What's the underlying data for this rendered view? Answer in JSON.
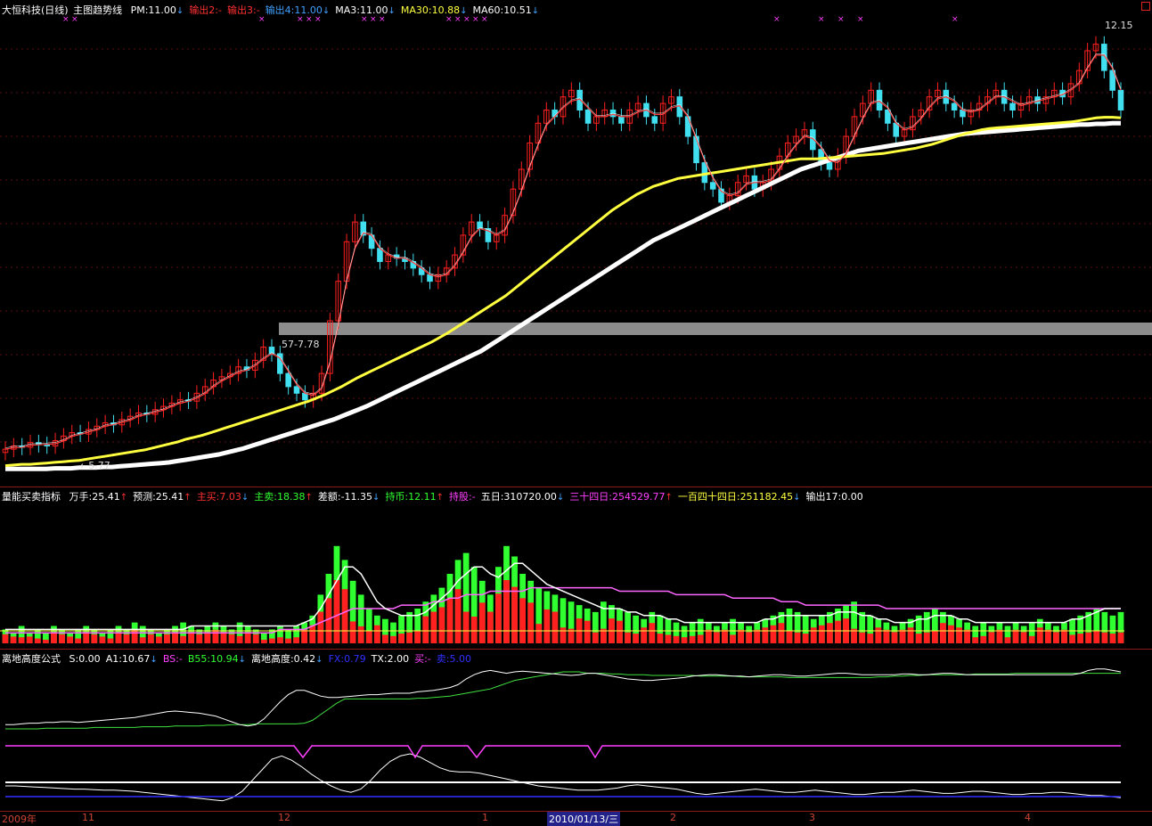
{
  "main": {
    "title": "大恒科技(日线)",
    "indicator": "主图趋势线",
    "items": [
      {
        "text": "PM:11.00",
        "color": "#ffffff",
        "arrow": "↓"
      },
      {
        "text": "输出2:-",
        "color": "#ff3030",
        "arrow": ""
      },
      {
        "text": "输出3:-",
        "color": "#ff3030",
        "arrow": ""
      },
      {
        "text": "输出4:11.00",
        "color": "#40a0ff",
        "arrow": "↓"
      },
      {
        "text": "MA3:11.00",
        "color": "#ffffff",
        "arrow": "↓"
      },
      {
        "text": "MA30:10.88",
        "color": "#ffff40",
        "arrow": "↓"
      },
      {
        "text": "MA60:10.51",
        "color": "#ffffff",
        "arrow": "↓"
      }
    ],
    "high_label": "12.15",
    "low_label": "5.77",
    "mid_label": "57-7.78"
  },
  "volume": {
    "title": "量能买卖指标",
    "items": [
      {
        "text": "万手:25.41",
        "color": "#ffffff",
        "arrow": "↑"
      },
      {
        "text": "预测:25.41",
        "color": "#ffffff",
        "arrow": "↑"
      },
      {
        "text": "主买:7.03",
        "color": "#ff3030",
        "arrow": "↓"
      },
      {
        "text": "主卖:18.38",
        "color": "#30ff30",
        "arrow": "↑"
      },
      {
        "text": "差额:-11.35",
        "color": "#ffffff",
        "arrow": "↓"
      },
      {
        "text": "持币:12.11",
        "color": "#30ff30",
        "arrow": "↑"
      },
      {
        "text": "持股:-",
        "color": "#ff40ff",
        "arrow": ""
      },
      {
        "text": "五日:310720.00",
        "color": "#ffffff",
        "arrow": "↓"
      },
      {
        "text": "三十四日:254529.77",
        "color": "#ff40ff",
        "arrow": "↑"
      },
      {
        "text": "一百四十四日:251182.45",
        "color": "#ffff40",
        "arrow": "↓"
      },
      {
        "text": "输出17:0.00",
        "color": "#ffffff",
        "arrow": ""
      }
    ]
  },
  "indicator": {
    "title": "离地高度公式",
    "items": [
      {
        "text": "S:0.00",
        "color": "#ffffff",
        "arrow": ""
      },
      {
        "text": "A1:10.67",
        "color": "#ffffff",
        "arrow": "↓"
      },
      {
        "text": "BS:-",
        "color": "#ff40ff",
        "arrow": ""
      },
      {
        "text": "B55:10.94",
        "color": "#30ff30",
        "arrow": "↓"
      },
      {
        "text": "离地高度:0.42",
        "color": "#ffffff",
        "arrow": "↓"
      },
      {
        "text": "FX:0.79",
        "color": "#3030ff",
        "arrow": ""
      },
      {
        "text": "TX:2.00",
        "color": "#ffffff",
        "arrow": ""
      },
      {
        "text": "买:-",
        "color": "#ff40ff",
        "arrow": ""
      },
      {
        "text": "卖:5.00",
        "color": "#3030ff",
        "arrow": ""
      }
    ]
  },
  "date_axis": {
    "labels": [
      "2009年",
      "11",
      "12",
      "1",
      "2",
      "3",
      "4"
    ],
    "selected": "2010/01/13/三"
  },
  "colors": {
    "up": "#ff2020",
    "down": "#40e0f0",
    "ma30": "#ffff40",
    "ma60": "#ffffff",
    "grid": "#8a1a1a",
    "vol_up": "#ff2020",
    "vol_down": "#30ff30"
  },
  "chart_data": [
    {
      "type": "candlestick",
      "title": "大恒科技(日线)",
      "ylim": [
        5.5,
        12.4
      ],
      "close": [
        5.85,
        5.9,
        5.88,
        5.95,
        5.92,
        5.9,
        5.98,
        6.05,
        6.1,
        6.08,
        6.15,
        6.2,
        6.25,
        6.22,
        6.3,
        6.35,
        6.4,
        6.38,
        6.45,
        6.5,
        6.55,
        6.6,
        6.58,
        6.7,
        6.8,
        6.9,
        6.95,
        7.0,
        7.1,
        7.05,
        7.2,
        7.4,
        7.3,
        7.0,
        6.8,
        6.7,
        6.6,
        6.7,
        7.0,
        7.8,
        8.4,
        9.0,
        9.3,
        9.1,
        8.9,
        8.7,
        8.8,
        8.75,
        8.7,
        8.6,
        8.5,
        8.4,
        8.5,
        8.6,
        8.8,
        9.1,
        9.3,
        9.2,
        9.0,
        9.1,
        9.4,
        9.8,
        10.1,
        10.5,
        10.8,
        11.0,
        10.9,
        11.2,
        11.3,
        11.0,
        10.8,
        10.9,
        11.0,
        10.9,
        10.8,
        11.0,
        11.1,
        10.9,
        10.8,
        11.1,
        11.2,
        10.9,
        10.6,
        10.2,
        9.9,
        9.8,
        9.6,
        9.7,
        9.9,
        10.0,
        9.8,
        9.9,
        10.1,
        10.3,
        10.5,
        10.6,
        10.7,
        10.4,
        10.2,
        10.1,
        10.3,
        10.6,
        10.9,
        11.1,
        11.3,
        11.0,
        10.8,
        10.6,
        10.7,
        10.9,
        11.0,
        11.2,
        11.3,
        11.1,
        11.0,
        10.9,
        11.0,
        11.1,
        11.2,
        11.3,
        11.1,
        11.0,
        11.1,
        11.2,
        11.1,
        11.2,
        11.3,
        11.2,
        11.4,
        11.6,
        11.9,
        12.0,
        11.6,
        11.3,
        11.0
      ],
      "ma30": [
        5.6,
        5.61,
        5.62,
        5.62,
        5.63,
        5.64,
        5.65,
        5.66,
        5.67,
        5.68,
        5.7,
        5.72,
        5.74,
        5.76,
        5.78,
        5.8,
        5.82,
        5.84,
        5.87,
        5.9,
        5.93,
        5.96,
        6.0,
        6.03,
        6.06,
        6.1,
        6.14,
        6.18,
        6.22,
        6.26,
        6.3,
        6.34,
        6.38,
        6.42,
        6.46,
        6.5,
        6.54,
        6.58,
        6.63,
        6.68,
        6.74,
        6.8,
        6.87,
        6.94,
        7.0,
        7.06,
        7.12,
        7.18,
        7.24,
        7.3,
        7.36,
        7.42,
        7.48,
        7.55,
        7.62,
        7.7,
        7.78,
        7.86,
        7.94,
        8.02,
        8.1,
        8.18,
        8.28,
        8.38,
        8.48,
        8.58,
        8.68,
        8.78,
        8.88,
        8.98,
        9.08,
        9.18,
        9.28,
        9.38,
        9.48,
        9.56,
        9.64,
        9.72,
        9.78,
        9.84,
        9.88,
        9.92,
        9.96,
        9.98,
        10.0,
        10.02,
        10.04,
        10.06,
        10.08,
        10.1,
        10.12,
        10.14,
        10.16,
        10.18,
        10.2,
        10.22,
        10.24,
        10.26,
        10.26,
        10.26,
        10.27,
        10.28,
        10.29,
        10.3,
        10.31,
        10.32,
        10.33,
        10.34,
        10.36,
        10.38,
        10.4,
        10.42,
        10.45,
        10.48,
        10.52,
        10.56,
        10.6,
        10.64,
        10.67,
        10.7,
        10.72,
        10.73,
        10.74,
        10.75,
        10.76,
        10.77,
        10.78,
        10.79,
        10.8,
        10.81,
        10.82,
        10.84,
        10.86,
        10.88,
        10.89,
        10.89,
        10.88
      ],
      "ma60": [
        5.55,
        5.55,
        5.55,
        5.55,
        5.55,
        5.55,
        5.56,
        5.56,
        5.56,
        5.57,
        5.57,
        5.57,
        5.58,
        5.58,
        5.59,
        5.6,
        5.61,
        5.62,
        5.63,
        5.64,
        5.65,
        5.67,
        5.69,
        5.71,
        5.73,
        5.75,
        5.77,
        5.8,
        5.83,
        5.86,
        5.9,
        5.94,
        5.98,
        6.02,
        6.06,
        6.1,
        6.14,
        6.18,
        6.22,
        6.26,
        6.3,
        6.35,
        6.4,
        6.45,
        6.5,
        6.56,
        6.62,
        6.68,
        6.74,
        6.8,
        6.86,
        6.92,
        6.98,
        7.04,
        7.1,
        7.16,
        7.22,
        7.28,
        7.34,
        7.42,
        7.5,
        7.58,
        7.66,
        7.74,
        7.82,
        7.9,
        7.98,
        8.06,
        8.14,
        8.22,
        8.3,
        8.38,
        8.46,
        8.54,
        8.62,
        8.7,
        8.78,
        8.86,
        8.94,
        9.02,
        9.08,
        9.14,
        9.2,
        9.26,
        9.32,
        9.38,
        9.44,
        9.5,
        9.56,
        9.62,
        9.68,
        9.74,
        9.8,
        9.86,
        9.92,
        9.98,
        10.04,
        10.1,
        10.14,
        10.18,
        10.22,
        10.26,
        10.3,
        10.34,
        10.38,
        10.4,
        10.42,
        10.44,
        10.46,
        10.48,
        10.5,
        10.52,
        10.54,
        10.56,
        10.58,
        10.6,
        10.62,
        10.64,
        10.65,
        10.66,
        10.67,
        10.68,
        10.69,
        10.7,
        10.71,
        10.72,
        10.73,
        10.74,
        10.75,
        10.76,
        10.77,
        10.78,
        10.78,
        10.79,
        10.79,
        10.8,
        10.8
      ]
    },
    {
      "type": "bar",
      "title": "量能买卖指标",
      "ylim": [
        0,
        40
      ],
      "values": [
        4,
        3,
        5,
        3,
        4,
        3,
        5,
        4,
        3,
        4,
        5,
        4,
        3,
        4,
        5,
        4,
        6,
        5,
        4,
        3,
        4,
        5,
        6,
        5,
        4,
        5,
        6,
        5,
        4,
        6,
        5,
        4,
        3,
        4,
        5,
        4,
        5,
        6,
        8,
        14,
        20,
        28,
        24,
        18,
        14,
        10,
        8,
        7,
        6,
        8,
        9,
        10,
        12,
        14,
        16,
        20,
        24,
        26,
        22,
        18,
        14,
        22,
        28,
        25,
        20,
        18,
        16,
        15,
        14,
        13,
        12,
        11,
        10,
        9,
        12,
        11,
        10,
        9,
        8,
        7,
        9,
        8,
        7,
        6,
        5,
        6,
        7,
        6,
        5,
        6,
        7,
        6,
        5,
        6,
        7,
        8,
        9,
        10,
        9,
        8,
        7,
        8,
        9,
        10,
        11,
        12,
        9,
        8,
        7,
        6,
        5,
        6,
        7,
        8,
        9,
        10,
        9,
        8,
        7,
        6,
        5,
        6,
        5,
        6,
        5,
        6,
        5,
        6,
        7,
        6,
        5,
        6,
        7,
        8,
        9,
        10,
        9,
        8,
        9
      ],
      "line_white": [
        4,
        4,
        4,
        4,
        4,
        4,
        4,
        4,
        4,
        4,
        4,
        4,
        4,
        4,
        4,
        4,
        4,
        4,
        4,
        4,
        4,
        4,
        4,
        5,
        5,
        5,
        5,
        5,
        5,
        5,
        5,
        5,
        5,
        5,
        5,
        5,
        5,
        6,
        7,
        10,
        14,
        18,
        22,
        22,
        20,
        16,
        12,
        10,
        9,
        8,
        8,
        8,
        9,
        11,
        13,
        15,
        18,
        20,
        22,
        22,
        20,
        19,
        21,
        23,
        23,
        21,
        19,
        17,
        16,
        15,
        14,
        13,
        12,
        11,
        10,
        10,
        10,
        9,
        9,
        8,
        8,
        8,
        7,
        7,
        6,
        6,
        6,
        6,
        6,
        6,
        6,
        6,
        6,
        6,
        7,
        7,
        8,
        8,
        8,
        8,
        8,
        8,
        8,
        9,
        9,
        9,
        8,
        8,
        7,
        7,
        6,
        6,
        6,
        7,
        7,
        8,
        8,
        8,
        7,
        7,
        6,
        6,
        6,
        6,
        6,
        6,
        6,
        6,
        6,
        6,
        6,
        6,
        7,
        7,
        8,
        9,
        10,
        10,
        10
      ],
      "line_pink": [
        3,
        3,
        3,
        3,
        3,
        3,
        3,
        3,
        3,
        3,
        3,
        3,
        3,
        3,
        3,
        3,
        3,
        3,
        3,
        3,
        3,
        3,
        3,
        3,
        3,
        3,
        3,
        3,
        3,
        3,
        3,
        3,
        3,
        3,
        4,
        4,
        4,
        4,
        5,
        6,
        7,
        8,
        9,
        10,
        10,
        10,
        10,
        10,
        10,
        11,
        11,
        11,
        11,
        12,
        12,
        13,
        13,
        14,
        14,
        14,
        15,
        15,
        15,
        15,
        15,
        16,
        16,
        16,
        16,
        16,
        16,
        16,
        16,
        16,
        16,
        16,
        15,
        15,
        15,
        15,
        15,
        15,
        15,
        14,
        14,
        14,
        14,
        14,
        14,
        14,
        13,
        13,
        13,
        13,
        13,
        13,
        12,
        12,
        12,
        11,
        11,
        11,
        11,
        11,
        11,
        11,
        11,
        11,
        11,
        10,
        10,
        10,
        10,
        10,
        10,
        10,
        10,
        10,
        10,
        10,
        10,
        10,
        10,
        10,
        10,
        10,
        10,
        10,
        10,
        10,
        10,
        10,
        10,
        10,
        10,
        10,
        10,
        10,
        10
      ]
    },
    {
      "type": "line",
      "title": "离地高度公式",
      "ylim": [
        0,
        100
      ],
      "green": [
        10,
        10,
        10,
        10,
        10,
        11,
        11,
        11,
        11,
        11,
        11,
        12,
        12,
        12,
        12,
        12,
        12,
        13,
        13,
        13,
        13,
        14,
        14,
        14,
        14,
        15,
        15,
        15,
        16,
        16,
        16,
        17,
        17,
        17,
        17,
        17,
        17,
        18,
        22,
        30,
        38,
        46,
        52,
        52,
        52,
        52,
        52,
        52,
        52,
        52,
        52,
        53,
        53,
        54,
        55,
        56,
        58,
        60,
        62,
        64,
        66,
        70,
        74,
        78,
        80,
        82,
        84,
        86,
        88,
        90,
        90,
        90,
        88,
        88,
        88,
        87,
        87,
        86,
        86,
        86,
        85,
        85,
        85,
        85,
        85,
        85,
        84,
        84,
        84,
        84,
        84,
        83,
        83,
        83,
        83,
        83,
        83,
        82,
        82,
        82,
        82,
        82,
        82,
        82,
        82,
        82,
        82,
        82,
        83,
        83,
        84,
        84,
        85,
        85,
        86,
        86,
        86,
        86,
        86,
        86,
        87,
        87,
        87,
        87,
        87,
        88,
        88,
        88,
        88,
        88,
        88,
        88,
        88,
        88,
        88,
        88,
        88,
        88,
        88
      ],
      "white": [
        16,
        16,
        17,
        18,
        18,
        19,
        19,
        20,
        20,
        19,
        20,
        21,
        22,
        23,
        24,
        25,
        26,
        28,
        30,
        32,
        34,
        35,
        34,
        33,
        32,
        30,
        28,
        24,
        20,
        16,
        14,
        16,
        24,
        36,
        48,
        58,
        64,
        64,
        60,
        56,
        54,
        54,
        55,
        56,
        57,
        58,
        58,
        59,
        60,
        60,
        60,
        62,
        63,
        64,
        66,
        68,
        72,
        80,
        86,
        90,
        92,
        90,
        88,
        90,
        91,
        90,
        89,
        88,
        87,
        86,
        85,
        86,
        88,
        88,
        86,
        84,
        82,
        80,
        79,
        78,
        78,
        79,
        80,
        81,
        82,
        84,
        85,
        86,
        86,
        85,
        84,
        84,
        83,
        84,
        85,
        86,
        86,
        85,
        84,
        84,
        85,
        86,
        87,
        88,
        88,
        87,
        86,
        86,
        86,
        86,
        86,
        87,
        87,
        86,
        86,
        87,
        88,
        88,
        87,
        86,
        86,
        86,
        86,
        86,
        86,
        86,
        86,
        86,
        86,
        86,
        86,
        86,
        86,
        88,
        92,
        94,
        94,
        92,
        90
      ],
      "bottom_white": [
        30,
        30,
        29,
        28,
        27,
        26,
        25,
        24,
        24,
        23,
        22,
        22,
        21,
        20,
        18,
        16,
        14,
        12,
        10,
        8,
        6,
        4,
        2,
        8,
        20,
        40,
        60,
        80,
        86,
        78,
        66,
        52,
        40,
        30,
        22,
        18,
        24,
        40,
        60,
        76,
        86,
        90,
        84,
        74,
        64,
        58,
        56,
        56,
        54,
        50,
        46,
        42,
        38,
        34,
        30,
        28,
        26,
        24,
        22,
        22,
        22,
        24,
        26,
        30,
        32,
        30,
        28,
        26,
        24,
        20,
        16,
        14,
        16,
        18,
        20,
        22,
        24,
        22,
        20,
        18,
        18,
        20,
        22,
        20,
        18,
        16,
        14,
        14,
        16,
        18,
        18,
        20,
        22,
        20,
        18,
        16,
        16,
        18,
        20,
        20,
        18,
        16,
        14,
        14,
        16,
        16,
        18,
        18,
        16,
        14,
        12,
        12,
        10,
        8
      ]
    }
  ]
}
